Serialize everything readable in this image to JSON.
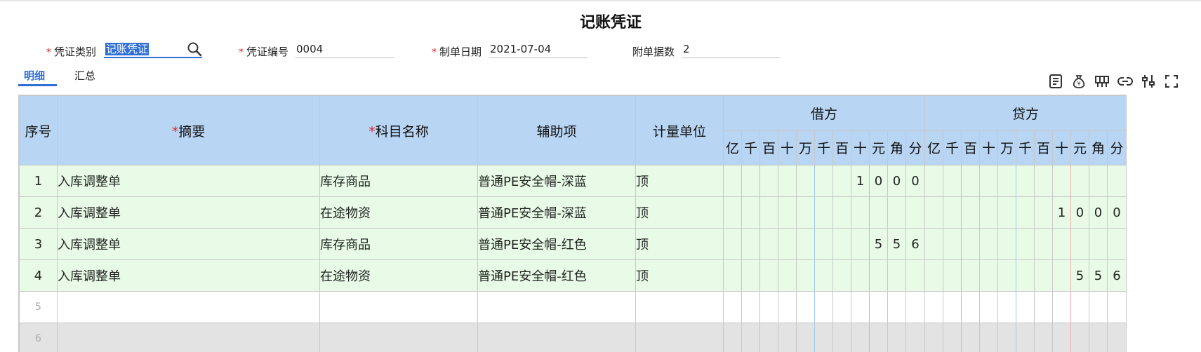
{
  "title": "记账凭证",
  "form": {
    "voucher_type": {
      "label": "凭证类别",
      "value": "记账凭证"
    },
    "voucher_no": {
      "label": "凭证编号",
      "value": "0004"
    },
    "date": {
      "label": "制单日期",
      "value": "2021-07-04"
    },
    "attachments": {
      "label": "附单据数",
      "value": "2"
    }
  },
  "tabs": [
    "明细",
    "汇总"
  ],
  "toolbar": [
    "list-icon",
    "money-bag-icon",
    "chart-icon",
    "link-icon",
    "adjust-icon",
    "fullscreen-icon"
  ],
  "table": {
    "headers": {
      "seq": "序号",
      "summary": "摘要",
      "account": "科目名称",
      "auxiliary": "辅助项",
      "unit": "计量单位",
      "debit": "借方",
      "credit": "贷方",
      "digits": [
        "亿",
        "千",
        "百",
        "十",
        "万",
        "千",
        "百",
        "十",
        "元",
        "角",
        "分"
      ]
    },
    "rows": [
      {
        "seq": "1",
        "summary": "入库调整单",
        "account": "库存商品",
        "auxiliary": "普通PE安全帽-深蓝",
        "unit": "顶",
        "debit": [
          "",
          "",
          "",
          "",
          "",
          "",
          "",
          "1",
          "0",
          "0",
          "0"
        ],
        "credit": [
          "",
          "",
          "",
          "",
          "",
          "",
          "",
          "",
          "",
          "",
          ""
        ]
      },
      {
        "seq": "2",
        "summary": "入库调整单",
        "account": "在途物资",
        "auxiliary": "普通PE安全帽-深蓝",
        "unit": "顶",
        "debit": [
          "",
          "",
          "",
          "",
          "",
          "",
          "",
          "",
          "",
          "",
          ""
        ],
        "credit": [
          "",
          "",
          "",
          "",
          "",
          "",
          "",
          "1",
          "0",
          "0",
          "0"
        ]
      },
      {
        "seq": "3",
        "summary": "入库调整单",
        "account": "库存商品",
        "auxiliary": "普通PE安全帽-红色",
        "unit": "顶",
        "debit": [
          "",
          "",
          "",
          "",
          "",
          "",
          "",
          "",
          "5",
          "5",
          "6"
        ],
        "credit": [
          "",
          "",
          "",
          "",
          "",
          "",
          "",
          "",
          "",
          "",
          ""
        ]
      },
      {
        "seq": "4",
        "summary": "入库调整单",
        "account": "在途物资",
        "auxiliary": "普通PE安全帽-红色",
        "unit": "顶",
        "debit": [
          "",
          "",
          "",
          "",
          "",
          "",
          "",
          "",
          "",
          "",
          ""
        ],
        "credit": [
          "",
          "",
          "",
          "",
          "",
          "",
          "",
          "",
          "5",
          "5",
          "6"
        ]
      },
      {
        "seq": "5",
        "summary": "",
        "account": "",
        "auxiliary": "",
        "unit": "",
        "debit": [
          "",
          "",
          "",
          "",
          "",
          "",
          "",
          "",
          "",
          "",
          ""
        ],
        "credit": [
          "",
          "",
          "",
          "",
          "",
          "",
          "",
          "",
          "",
          "",
          ""
        ]
      },
      {
        "seq": "6",
        "summary": "",
        "account": "",
        "auxiliary": "",
        "unit": "",
        "debit": [
          "",
          "",
          "",
          "",
          "",
          "",
          "",
          "",
          "",
          "",
          ""
        ],
        "credit": [
          "",
          "",
          "",
          "",
          "",
          "",
          "",
          "",
          "",
          "",
          ""
        ]
      }
    ]
  }
}
